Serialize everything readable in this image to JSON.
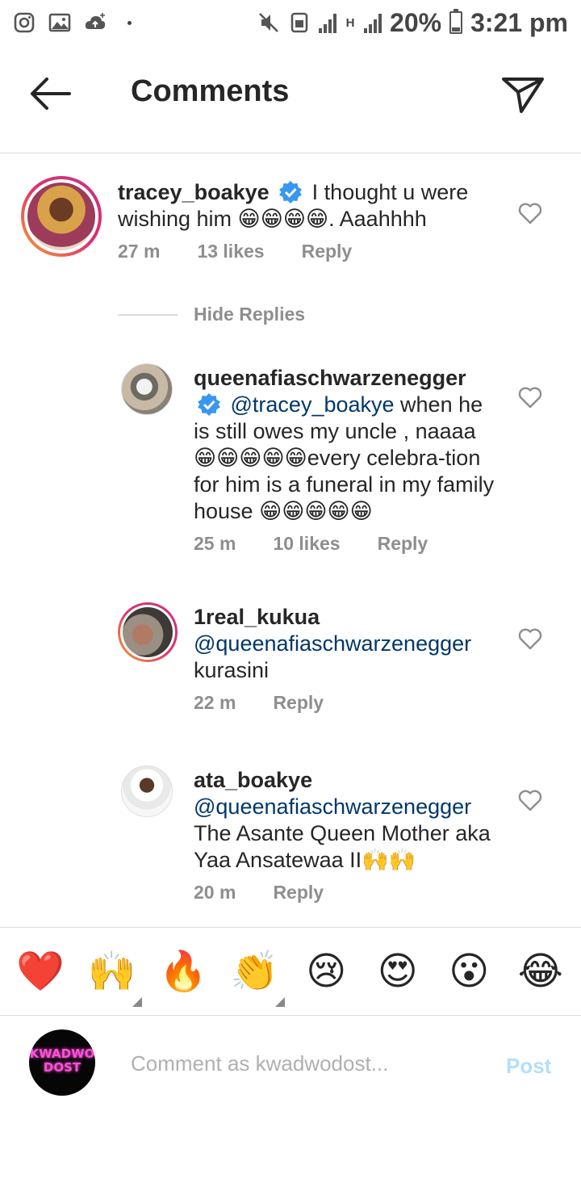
{
  "status_bar": {
    "battery": "20%",
    "time": "3:21 pm",
    "network": "H",
    "icons": [
      "instagram-icon",
      "gallery-icon",
      "cloud-upload-icon",
      "mute-icon",
      "nfc-icon",
      "signal-icon",
      "battery-icon"
    ]
  },
  "header": {
    "title": "Comments",
    "back_icon": "arrow-left-icon",
    "share_icon": "send-icon"
  },
  "comments": [
    {
      "username": "tracey_boakye",
      "verified": true,
      "text": "I thought u were wishing him 😁😁😁😁. Aaahhhh",
      "time": "27 m",
      "likes": "13 likes",
      "reply": "Reply",
      "avatar_color": "#c98a3a"
    }
  ],
  "hide_replies": "Hide Replies",
  "replies": [
    {
      "username": "queenafiaschwarzenegger",
      "verified": true,
      "mention": "@tracey_boakye",
      "text": "when he is still owes my uncle , naaaa 😁😁😁😁😁every celebra-tion for him is a funeral in my family house 😁😁😁😁😁",
      "time": "25 m",
      "likes": "10 likes",
      "reply": "Reply"
    },
    {
      "username": "1real_kukua",
      "verified": false,
      "mention": "@queenafiaschwarzenegger",
      "text": "kurasini",
      "time": "22 m",
      "reply": "Reply"
    },
    {
      "username": "ata_boakye",
      "verified": false,
      "mention": "@queenafiaschwarzenegger",
      "text": "The Asante Queen Mother aka Yaa Ansatewaa II🙌🙌",
      "time": "20 m",
      "reply": "Reply"
    }
  ],
  "emoji_bar": [
    "❤️",
    "🙌",
    "🔥",
    "👏",
    "😢",
    "😍",
    "😮",
    "😂"
  ],
  "composer": {
    "avatar_text_1": "KWADWO",
    "avatar_text_2": "DOST",
    "placeholder": "Comment as kwadwodost...",
    "post_label": "Post"
  },
  "colors": {
    "mention": "#00376b",
    "meta": "#8e8e8e",
    "post_disabled": "#b2dffc",
    "verified": "#3897f0"
  }
}
